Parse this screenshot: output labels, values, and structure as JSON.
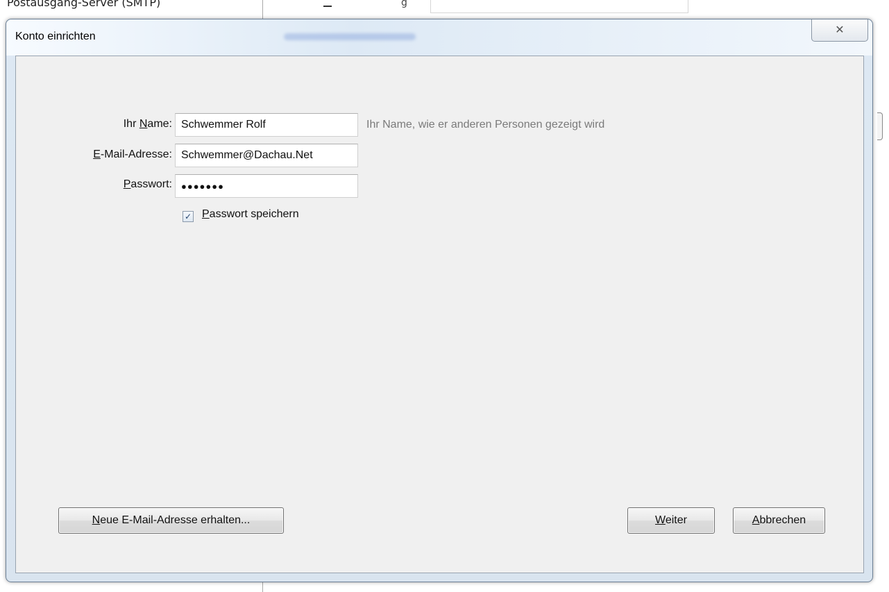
{
  "background": {
    "section_label": "Postausgang-Server (SMTP)",
    "partial_char": "g"
  },
  "dialog": {
    "title": "Konto einrichten",
    "close_glyph": "✕"
  },
  "form": {
    "name": {
      "label_pre": "Ihr ",
      "label_access": "N",
      "label_post": "ame:",
      "value": "Schwemmer Rolf",
      "hint": "Ihr Name, wie er anderen Personen gezeigt wird"
    },
    "email": {
      "label_access": "E",
      "label_post": "-Mail-Adresse:",
      "value": "Schwemmer@Dachau.Net"
    },
    "password": {
      "label_access": "P",
      "label_post": "asswort:",
      "value_masked": "●●●●●●●"
    },
    "remember": {
      "checked": true,
      "check_glyph": "✓",
      "label_access": "P",
      "label_post": "asswort speichern"
    }
  },
  "buttons": {
    "new_address": {
      "access": "N",
      "rest": "eue E-Mail-Adresse erhalten..."
    },
    "next": {
      "access": "W",
      "rest": "eiter"
    },
    "cancel": {
      "access": "A",
      "rest": "bbrechen"
    }
  }
}
